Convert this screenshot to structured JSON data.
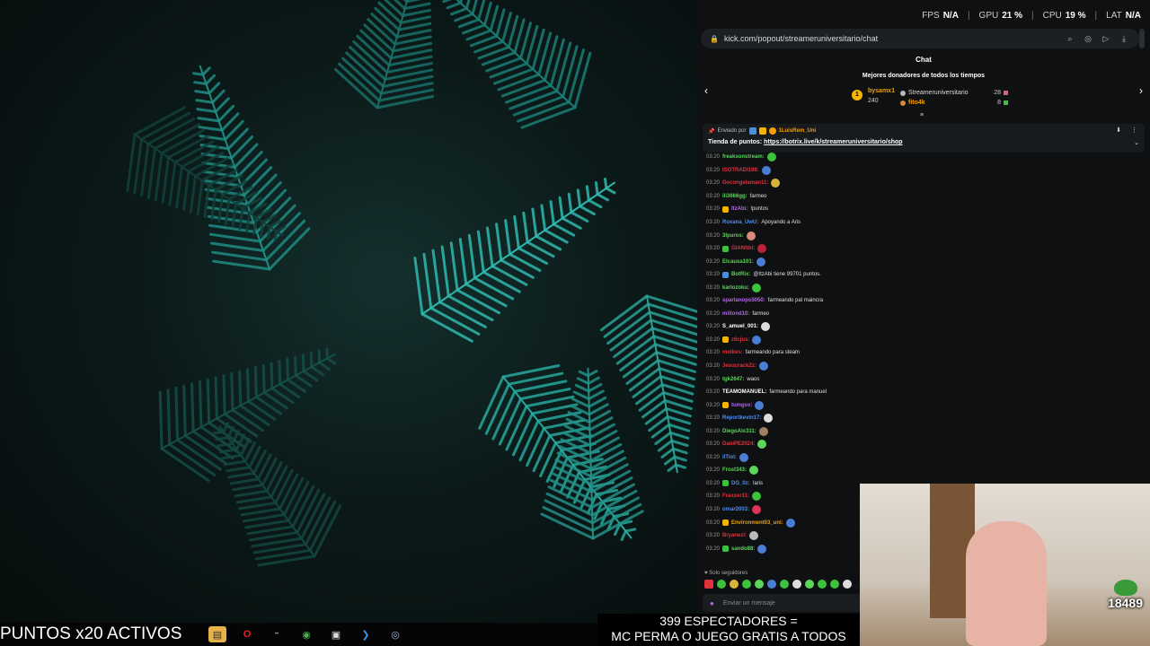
{
  "overlay": {
    "fps_label": "FPS",
    "fps_value": "N/A",
    "gpu_label": "GPU",
    "gpu_value": "21 %",
    "cpu_label": "CPU",
    "cpu_value": "19 %",
    "lat_label": "LAT",
    "lat_value": "N/A"
  },
  "browser": {
    "url": "kick.com/popout/streameruniversitario/chat"
  },
  "chat": {
    "title": "Chat",
    "donors_heading": "Mejores donadores de todos los tiempos",
    "donor1": {
      "rank": "1",
      "name": "bysamx1",
      "amount": "240"
    },
    "donor2": {
      "name": "Streameruniversitario",
      "amount": "28"
    },
    "donor3": {
      "name": "fito4k",
      "amount": "8"
    },
    "pinned": {
      "sent_by": "Enviado por",
      "sender": "1LuisRem_Uni",
      "message_prefix": "Tienda de puntos:",
      "link": "https://botrix.live/k/streameruniversitario/shop"
    },
    "messages": [
      {
        "time": "03:20",
        "user": "freaksonstream:",
        "text": "",
        "color": "#5bd65b",
        "emote": "#3cc23c"
      },
      {
        "time": "03:20",
        "user": "ISOTRADI198:",
        "text": "",
        "color": "#e0323c",
        "emote": "#4a7dd6"
      },
      {
        "time": "03:20",
        "user": "Gecongelaman11:",
        "text": "",
        "color": "#e0323c",
        "emote": "#d9b33a"
      },
      {
        "time": "03:20",
        "user": "ili3666gg:",
        "text": "farmeo",
        "color": "#5bd65b",
        "emote": ""
      },
      {
        "time": "03:20",
        "user": "ItzAbi:",
        "text": "!puntos",
        "color": "#b867e8",
        "emote": "",
        "badge": "#f4b400"
      },
      {
        "time": "03:20",
        "user": "Roxana_UwU:",
        "text": "Apoyando a Aris",
        "color": "#4f8ef0",
        "emote": ""
      },
      {
        "time": "03:20",
        "user": "3lpuros:",
        "text": "",
        "color": "#5bd65b",
        "emote": "#d98a7a"
      },
      {
        "time": "03:20",
        "user": "GIANttbl:",
        "text": "",
        "color": "#e0323c",
        "emote": "#c0203a",
        "badge": "#3cc23c"
      },
      {
        "time": "03:20",
        "user": "Elcausa101:",
        "text": "",
        "color": "#5bd65b",
        "emote": "#4a7dd6"
      },
      {
        "time": "03:20",
        "user": "BotRix:",
        "text": "@ItzAbi tiene 99701 puntos.",
        "color": "#5bd65b",
        "emote": "",
        "badge": "#4a90d9"
      },
      {
        "time": "03:20",
        "user": "karlozoku:",
        "text": "",
        "color": "#5bd65b",
        "emote": "#3cc23c"
      },
      {
        "time": "03:20",
        "user": "spartanops5050:",
        "text": "farmeando pal maincra",
        "color": "#b867e8",
        "emote": ""
      },
      {
        "time": "03:20",
        "user": "miltond10:",
        "text": "farmeo",
        "color": "#b867e8",
        "emote": ""
      },
      {
        "time": "03:20",
        "user": "S_amuel_001:",
        "text": "",
        "color": "#ffffff",
        "emote": "#dddddd"
      },
      {
        "time": "03:20",
        "user": "z6cjus:",
        "text": "",
        "color": "#e0323c",
        "emote": "#4a7dd6",
        "badge": "#f4b400"
      },
      {
        "time": "03:20",
        "user": "molkes:",
        "text": "farmeando para steam",
        "color": "#e0323c",
        "emote": ""
      },
      {
        "time": "03:20",
        "user": "JesucrackZz:",
        "text": "",
        "color": "#e0323c",
        "emote": "#4a7dd6"
      },
      {
        "time": "03:20",
        "user": "tgk2647:",
        "text": "waos",
        "color": "#5bd65b",
        "emote": ""
      },
      {
        "time": "03:20",
        "user": "TEAMOMANUEL:",
        "text": "farmeando para manuel",
        "color": "#ffffff",
        "emote": ""
      },
      {
        "time": "03:20",
        "user": "tumgsv:",
        "text": "",
        "color": "#b867e8",
        "emote": "#4a7dd6",
        "badge": "#f4b400"
      },
      {
        "time": "03:20",
        "user": "Reportkevin17:",
        "text": "",
        "color": "#4f8ef0",
        "emote": "#dddddd"
      },
      {
        "time": "03:20",
        "user": "DiegoAlx311:",
        "text": "",
        "color": "#5bd65b",
        "emote": "#a08060"
      },
      {
        "time": "03:20",
        "user": "DaniPE2024:",
        "text": "",
        "color": "#e0323c",
        "emote": "#5bd65b"
      },
      {
        "time": "03:20",
        "user": "ilTiol:",
        "text": "",
        "color": "#4f8ef0",
        "emote": "#4a7dd6"
      },
      {
        "time": "03:20",
        "user": "Frost343:",
        "text": "",
        "color": "#5bd65b",
        "emote": "#5bd65b"
      },
      {
        "time": "03:20",
        "user": "DG_0z:",
        "text": "!aris",
        "color": "#4f8ef0",
        "emote": "",
        "badge": "#3cc23c"
      },
      {
        "time": "03:20",
        "user": "Fraxxer11:",
        "text": "",
        "color": "#e0323c",
        "emote": "#3cc23c"
      },
      {
        "time": "03:20",
        "user": "omar2003:",
        "text": "",
        "color": "#4f8ef0",
        "emote": "#e0325a"
      },
      {
        "time": "03:20",
        "user": "Environment03_uni:",
        "text": "",
        "color": "#f4a000",
        "emote": "#4a7dd6",
        "badge": "#f4b400"
      },
      {
        "time": "03:20",
        "user": "Bryanezi:",
        "text": "",
        "color": "#e0323c",
        "emote": "#bbbbbb"
      },
      {
        "time": "03:20",
        "user": "sando88:",
        "text": "",
        "color": "#5bd65b",
        "emote": "#4a7dd6",
        "badge": "#3cc23c"
      }
    ],
    "followers_only": "Solo seguidores",
    "input_placeholder": "Enviar un mensaje"
  },
  "webcam": {
    "counter": "18489"
  },
  "bottom": {
    "points_banner": "PUNTOS x20 ACTIVOS",
    "viewers_line1": "399 ESPECTADORES =",
    "viewers_line2": "MC PERMA O JUEGO GRATIS A TODOS"
  },
  "taskbar": {
    "icons": [
      "folder-icon",
      "opera-icon",
      "app-icon",
      "chrome-icon",
      "window-icon",
      "vscode-icon",
      "steam-icon"
    ]
  }
}
